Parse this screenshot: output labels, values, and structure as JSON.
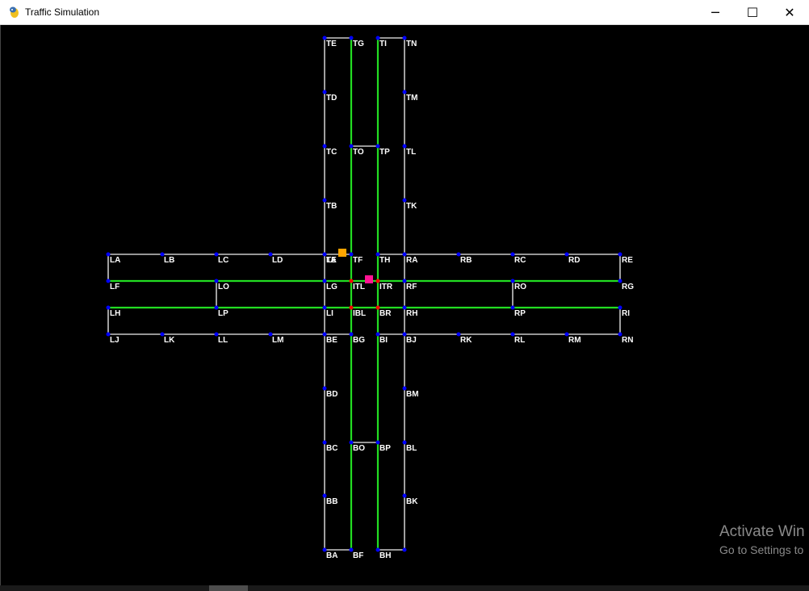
{
  "window": {
    "title": "Traffic Simulation",
    "minimize_icon": "─",
    "maximize_icon": "☐",
    "close_icon": "✕"
  },
  "colors": {
    "background": "#000000",
    "road": "#c8c8c8",
    "lane": "#22dd22",
    "node": "#0000ff",
    "signal": "#ff0000",
    "car_orange": "#ffa500",
    "car_pink": "#ff1493"
  },
  "watermark": {
    "line1": "Activate Win",
    "line2": "Go to Settings to"
  },
  "node_labels": [
    "TE",
    "TG",
    "TI",
    "TN",
    "TD",
    "TM",
    "TC",
    "TO",
    "TP",
    "TL",
    "TB",
    "TK",
    "LA",
    "LB",
    "LC",
    "LD",
    "LE",
    "TA",
    "TF",
    "TH",
    "RA",
    "RB",
    "RC",
    "RD",
    "RE",
    "LF",
    "LO",
    "LG",
    "ITL",
    "ITR",
    "RF",
    "RO",
    "RG",
    "LH",
    "LP",
    "LI",
    "IBL",
    "BR",
    "RH",
    "RP",
    "RI",
    "LJ",
    "LK",
    "LL",
    "LM",
    "BE",
    "BG",
    "BI",
    "BJ",
    "RK",
    "RL",
    "RM",
    "RN",
    "BD",
    "BM",
    "BC",
    "BO",
    "BP",
    "BL",
    "BB",
    "BK",
    "BA",
    "BF",
    "BH"
  ]
}
